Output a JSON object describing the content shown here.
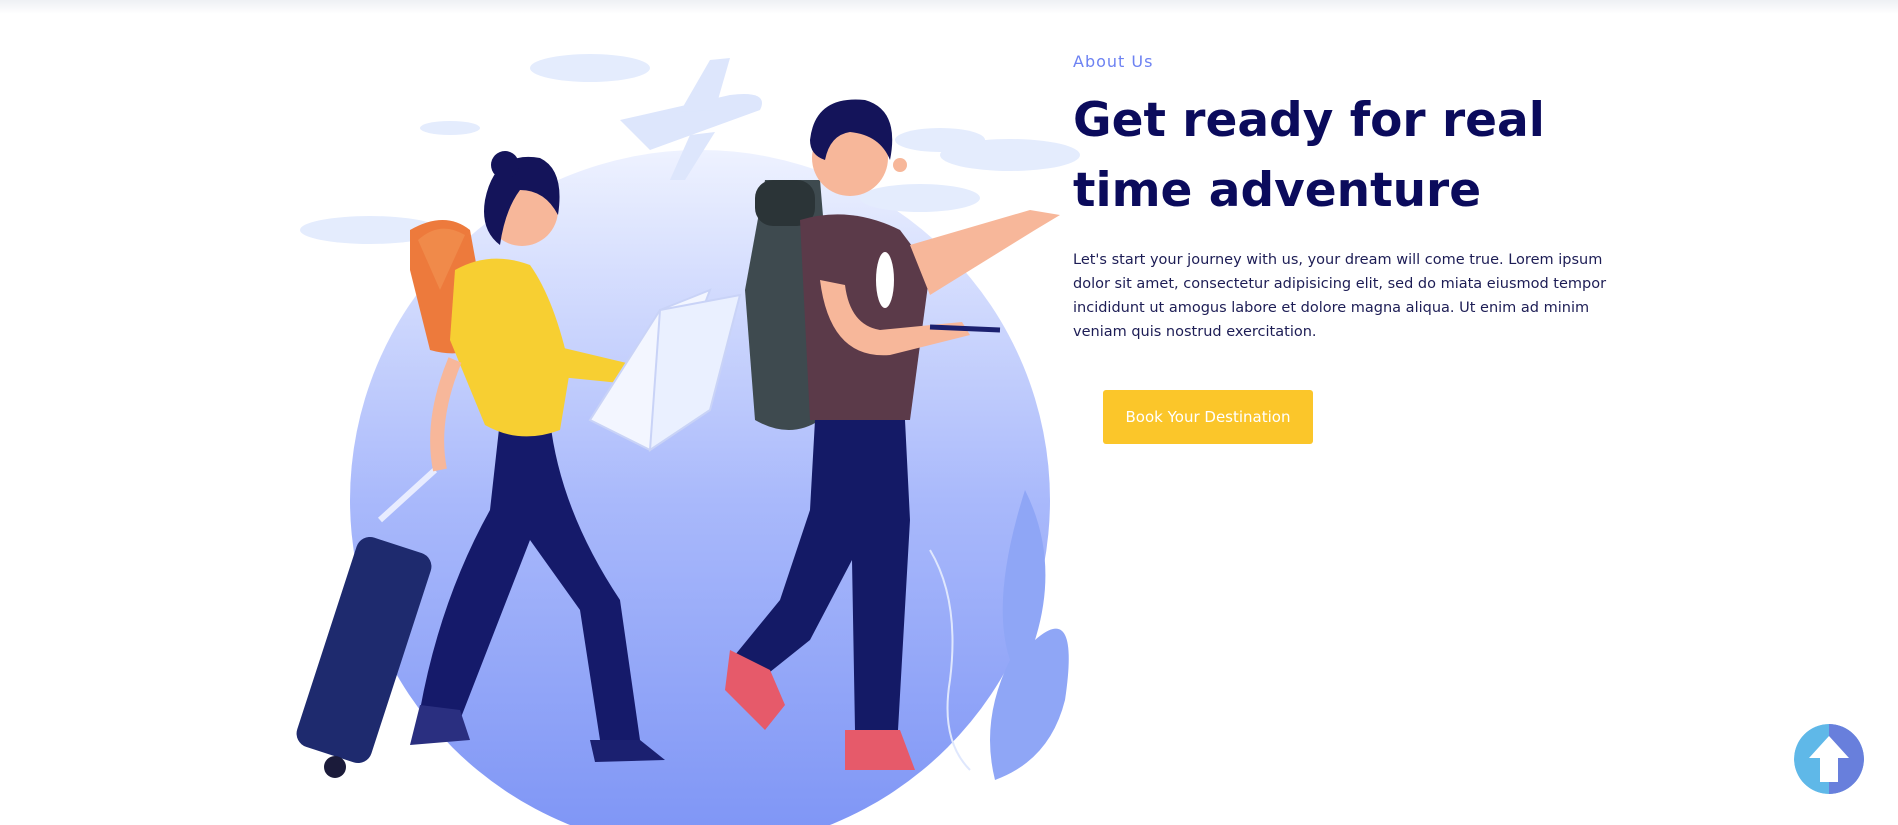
{
  "about": {
    "eyebrow": "About Us",
    "headline": "Get ready for real time adventure",
    "body": "Let's start your journey with us, your dream will come true. Lorem ipsum dolor sit amet, consectetur adipisicing elit, sed do miata eiusmod tempor incididunt ut amogus labore et dolore magna aliqua. Ut enim ad minim veniam quis nostrud exercitation.",
    "cta_label": "Book Your Destination"
  },
  "illustration": {
    "subject": "travelers-couple-illustration"
  },
  "scroll_top": {
    "icon": "arrow-up-icon"
  },
  "colors": {
    "accent": "#6d82f2",
    "heading": "#0b0b5c",
    "cta": "#fbc62a",
    "scroll_button": "#5fb8e8"
  }
}
